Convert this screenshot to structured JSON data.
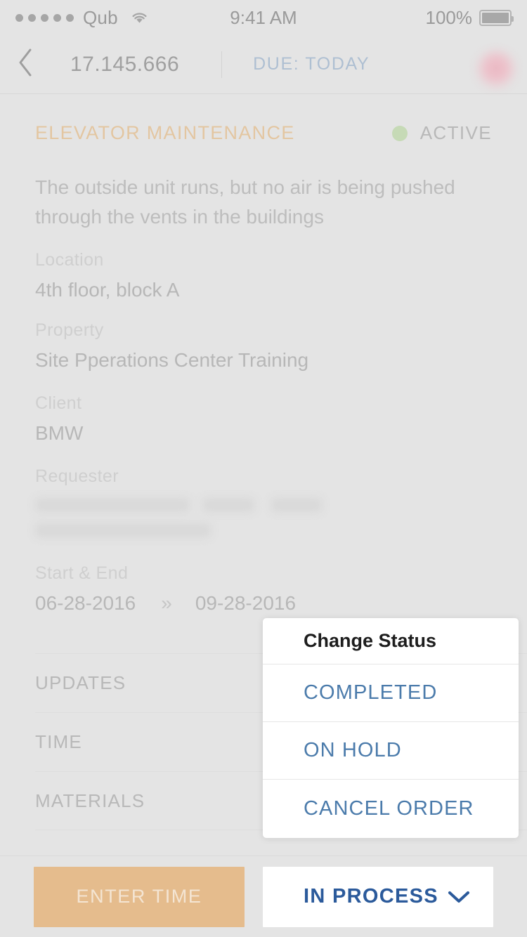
{
  "status_bar": {
    "carrier": "Qub",
    "signal_dots": 5,
    "wifi_icon": "wifi-icon",
    "time": "9:41 AM",
    "battery_pct": "100%",
    "battery_icon": "battery-full-icon"
  },
  "nav": {
    "back_icon": "chevron-left-icon",
    "title": "17.145.666",
    "due_label": "DUE: TODAY",
    "avatar": "user-avatar"
  },
  "work_order": {
    "title": "ELEVATOR MAINTENANCE",
    "status_label": "ACTIVE",
    "status_color": "#b5d49a",
    "title_color": "#e3b479",
    "description": "The outside unit runs, but no air is being pushed through the vents in the buildings",
    "fields": {
      "location_label": "Location",
      "location_value": "4th floor, block A",
      "property_label": "Property",
      "property_value": "Site Pperations Center Training",
      "client_label": "Client",
      "client_value": "BMW",
      "requester_label": "Requester",
      "requester_value": "",
      "dates_label": "Start & End",
      "start_date": "06-28-2016",
      "date_arrow": "»",
      "end_date": "09-28-2016"
    }
  },
  "list_rows": [
    {
      "label": "UPDATES"
    },
    {
      "label": "TIME"
    },
    {
      "label": "MATERIALS"
    }
  ],
  "popup": {
    "title": "Change Status",
    "options": [
      {
        "label": "COMPLETED"
      },
      {
        "label": "ON HOLD"
      },
      {
        "label": "CANCEL ORDER"
      }
    ],
    "link_color": "#4b7bab"
  },
  "bottom_bar": {
    "enter_time_label": "ENTER TIME",
    "enter_time_color": "#e5bc8d",
    "status_label": "IN PROCESS",
    "status_color": "#2b5a9b",
    "chevron_icon": "chevron-down-icon"
  }
}
